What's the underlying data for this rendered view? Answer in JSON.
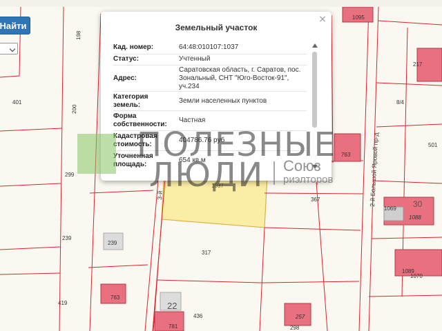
{
  "search": {
    "find_label": "Найти"
  },
  "popup": {
    "title": "Земельный участок",
    "close_glyph": "×",
    "rows": [
      {
        "label": "Кад. номер:",
        "value": "64:48:010107:1037"
      },
      {
        "label": "Статус:",
        "value": "Учтенный"
      },
      {
        "label": "Адрес:",
        "value": "Саратовская область, г. Саратов, пос. Зональный, СНТ \"Юго-Восток-91\", уч.234"
      },
      {
        "label": "Категория земель:",
        "value": "Земли населенных пунктов"
      },
      {
        "label": "Форма собственности:",
        "value": "Частная"
      },
      {
        "label": "Кадастровая стоимость:",
        "value": "404786.76 руб"
      },
      {
        "label": "Уточненная площадь:",
        "value": "654 кв.м"
      }
    ]
  },
  "watermark": {
    "line1": "ПОЛЕЗНЫЕ",
    "line2": "ЛЮДИ",
    "org": "Союз",
    "org_sub": "риэлторов"
  },
  "map": {
    "streets": [
      {
        "label": "2-й Большой Яровой пр-д"
      },
      {
        "label": "3-й"
      }
    ],
    "parcels": [
      {
        "label": "198"
      },
      {
        "label": "401"
      },
      {
        "label": "200"
      },
      {
        "label": "299"
      },
      {
        "label": "239"
      },
      {
        "label": "239"
      },
      {
        "label": "419"
      },
      {
        "label": "763"
      },
      {
        "label": "22"
      },
      {
        "label": "781"
      },
      {
        "label": "436"
      },
      {
        "label": "317"
      },
      {
        "label": "367"
      },
      {
        "label": "1037"
      },
      {
        "label": "1095"
      },
      {
        "label": "217"
      },
      {
        "label": "8/4"
      },
      {
        "label": "501"
      },
      {
        "label": "1069"
      },
      {
        "label": "1088"
      },
      {
        "label": "30"
      },
      {
        "label": "1089"
      },
      {
        "label": "1070"
      },
      {
        "label": "298"
      },
      {
        "label": "257"
      },
      {
        "label": "763"
      }
    ],
    "colors": {
      "background": "#fbf8f1",
      "parcel_border": "#d9232e",
      "selected_fill": "#fbeea4",
      "building_fill": "#e9707e",
      "street_border": "#d9232e"
    }
  }
}
